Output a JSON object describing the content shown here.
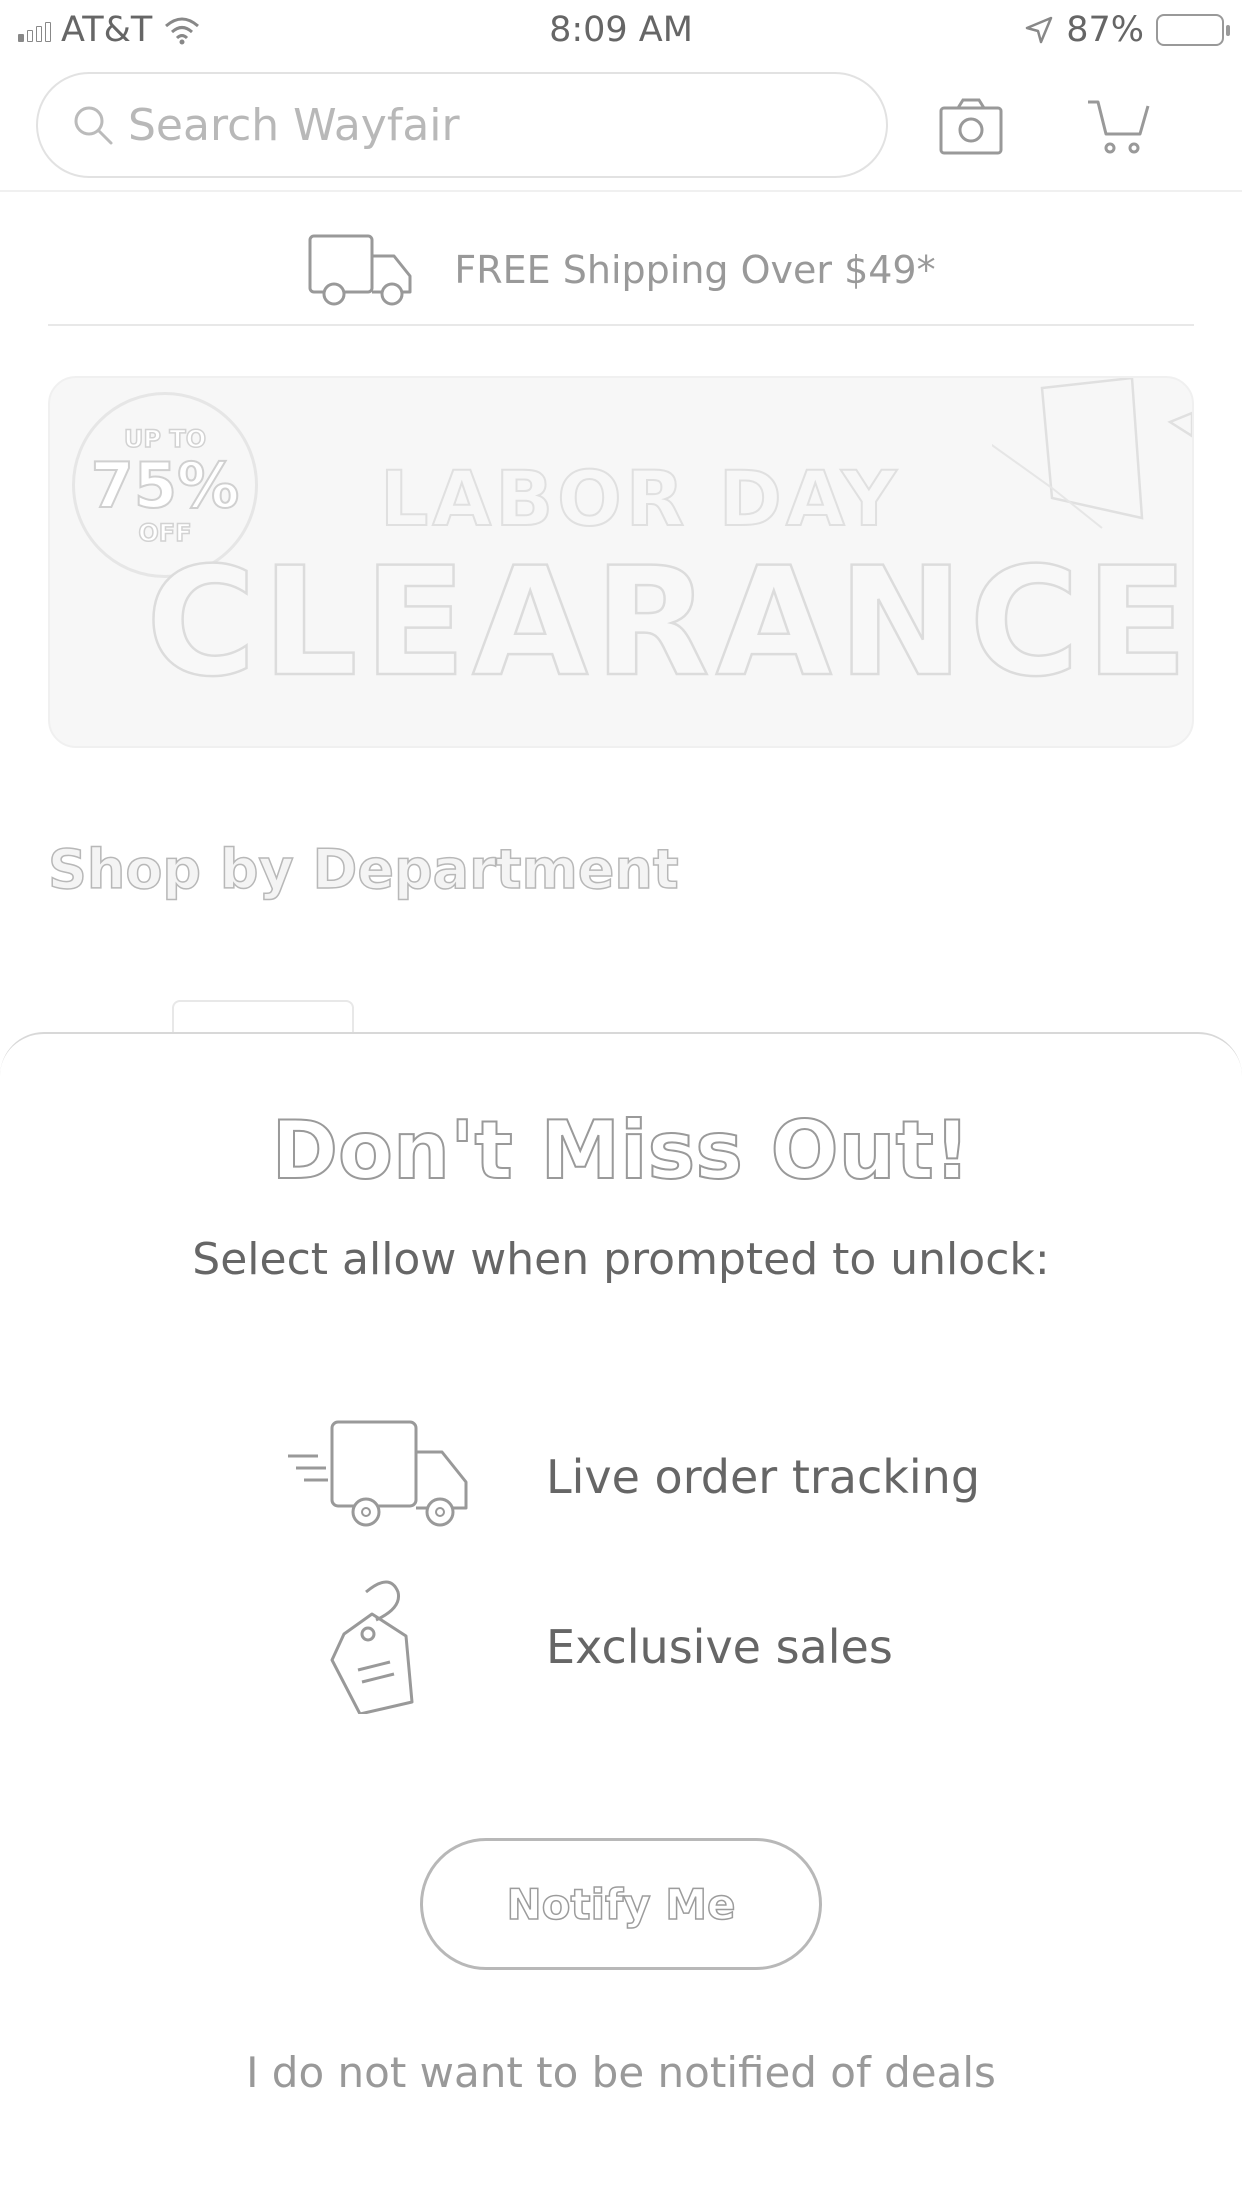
{
  "status_bar": {
    "carrier": "AT&T",
    "time": "8:09 AM",
    "battery": "87%"
  },
  "search": {
    "placeholder": "Search Wayfair"
  },
  "header": {
    "icons": [
      "search-icon",
      "camera-icon",
      "cart-icon"
    ]
  },
  "shipping_banner": {
    "text": "FREE Shipping Over $49*"
  },
  "promo": {
    "badge_top": "UP TO",
    "badge_percent": "75%",
    "badge_bottom": "OFF",
    "subtitle": "LABOR DAY",
    "title": "CLEARANCE"
  },
  "department": {
    "heading": "Shop by Department"
  },
  "modal": {
    "title": "Don't Miss Out!",
    "subtitle": "Select allow when prompted to unlock:",
    "benefits": [
      {
        "label": "Live order tracking",
        "icon": "delivery-truck-icon"
      },
      {
        "label": "Exclusive sales",
        "icon": "price-tag-icon"
      }
    ],
    "notify_button": "Notify Me",
    "decline_link": "I do not want to be notified of deals"
  },
  "colors": {
    "text_gray": "#666666",
    "light_gray": "#b8b8b8",
    "background": "#ffffff"
  }
}
